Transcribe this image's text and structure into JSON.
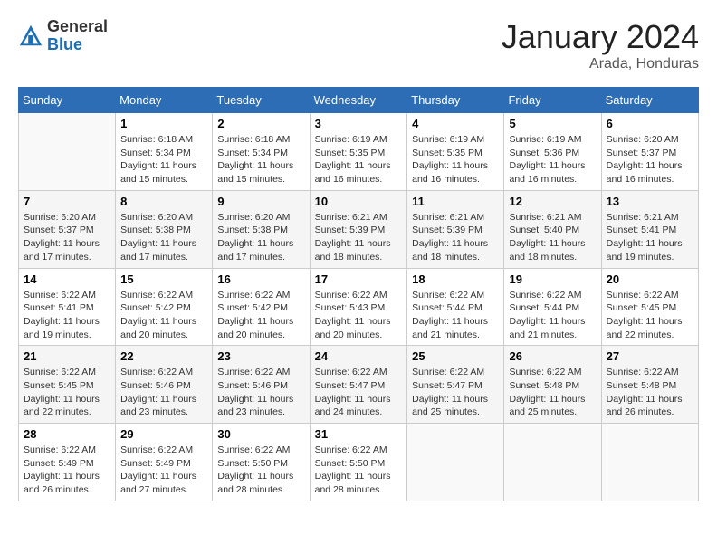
{
  "logo": {
    "general": "General",
    "blue": "Blue"
  },
  "title": {
    "month_year": "January 2024",
    "location": "Arada, Honduras"
  },
  "weekdays": [
    "Sunday",
    "Monday",
    "Tuesday",
    "Wednesday",
    "Thursday",
    "Friday",
    "Saturday"
  ],
  "weeks": [
    [
      {
        "day": "",
        "sunrise": "",
        "sunset": "",
        "daylight": ""
      },
      {
        "day": "1",
        "sunrise": "Sunrise: 6:18 AM",
        "sunset": "Sunset: 5:34 PM",
        "daylight": "Daylight: 11 hours and 15 minutes."
      },
      {
        "day": "2",
        "sunrise": "Sunrise: 6:18 AM",
        "sunset": "Sunset: 5:34 PM",
        "daylight": "Daylight: 11 hours and 15 minutes."
      },
      {
        "day": "3",
        "sunrise": "Sunrise: 6:19 AM",
        "sunset": "Sunset: 5:35 PM",
        "daylight": "Daylight: 11 hours and 16 minutes."
      },
      {
        "day": "4",
        "sunrise": "Sunrise: 6:19 AM",
        "sunset": "Sunset: 5:35 PM",
        "daylight": "Daylight: 11 hours and 16 minutes."
      },
      {
        "day": "5",
        "sunrise": "Sunrise: 6:19 AM",
        "sunset": "Sunset: 5:36 PM",
        "daylight": "Daylight: 11 hours and 16 minutes."
      },
      {
        "day": "6",
        "sunrise": "Sunrise: 6:20 AM",
        "sunset": "Sunset: 5:37 PM",
        "daylight": "Daylight: 11 hours and 16 minutes."
      }
    ],
    [
      {
        "day": "7",
        "sunrise": "Sunrise: 6:20 AM",
        "sunset": "Sunset: 5:37 PM",
        "daylight": "Daylight: 11 hours and 17 minutes."
      },
      {
        "day": "8",
        "sunrise": "Sunrise: 6:20 AM",
        "sunset": "Sunset: 5:38 PM",
        "daylight": "Daylight: 11 hours and 17 minutes."
      },
      {
        "day": "9",
        "sunrise": "Sunrise: 6:20 AM",
        "sunset": "Sunset: 5:38 PM",
        "daylight": "Daylight: 11 hours and 17 minutes."
      },
      {
        "day": "10",
        "sunrise": "Sunrise: 6:21 AM",
        "sunset": "Sunset: 5:39 PM",
        "daylight": "Daylight: 11 hours and 18 minutes."
      },
      {
        "day": "11",
        "sunrise": "Sunrise: 6:21 AM",
        "sunset": "Sunset: 5:39 PM",
        "daylight": "Daylight: 11 hours and 18 minutes."
      },
      {
        "day": "12",
        "sunrise": "Sunrise: 6:21 AM",
        "sunset": "Sunset: 5:40 PM",
        "daylight": "Daylight: 11 hours and 18 minutes."
      },
      {
        "day": "13",
        "sunrise": "Sunrise: 6:21 AM",
        "sunset": "Sunset: 5:41 PM",
        "daylight": "Daylight: 11 hours and 19 minutes."
      }
    ],
    [
      {
        "day": "14",
        "sunrise": "Sunrise: 6:22 AM",
        "sunset": "Sunset: 5:41 PM",
        "daylight": "Daylight: 11 hours and 19 minutes."
      },
      {
        "day": "15",
        "sunrise": "Sunrise: 6:22 AM",
        "sunset": "Sunset: 5:42 PM",
        "daylight": "Daylight: 11 hours and 20 minutes."
      },
      {
        "day": "16",
        "sunrise": "Sunrise: 6:22 AM",
        "sunset": "Sunset: 5:42 PM",
        "daylight": "Daylight: 11 hours and 20 minutes."
      },
      {
        "day": "17",
        "sunrise": "Sunrise: 6:22 AM",
        "sunset": "Sunset: 5:43 PM",
        "daylight": "Daylight: 11 hours and 20 minutes."
      },
      {
        "day": "18",
        "sunrise": "Sunrise: 6:22 AM",
        "sunset": "Sunset: 5:44 PM",
        "daylight": "Daylight: 11 hours and 21 minutes."
      },
      {
        "day": "19",
        "sunrise": "Sunrise: 6:22 AM",
        "sunset": "Sunset: 5:44 PM",
        "daylight": "Daylight: 11 hours and 21 minutes."
      },
      {
        "day": "20",
        "sunrise": "Sunrise: 6:22 AM",
        "sunset": "Sunset: 5:45 PM",
        "daylight": "Daylight: 11 hours and 22 minutes."
      }
    ],
    [
      {
        "day": "21",
        "sunrise": "Sunrise: 6:22 AM",
        "sunset": "Sunset: 5:45 PM",
        "daylight": "Daylight: 11 hours and 22 minutes."
      },
      {
        "day": "22",
        "sunrise": "Sunrise: 6:22 AM",
        "sunset": "Sunset: 5:46 PM",
        "daylight": "Daylight: 11 hours and 23 minutes."
      },
      {
        "day": "23",
        "sunrise": "Sunrise: 6:22 AM",
        "sunset": "Sunset: 5:46 PM",
        "daylight": "Daylight: 11 hours and 23 minutes."
      },
      {
        "day": "24",
        "sunrise": "Sunrise: 6:22 AM",
        "sunset": "Sunset: 5:47 PM",
        "daylight": "Daylight: 11 hours and 24 minutes."
      },
      {
        "day": "25",
        "sunrise": "Sunrise: 6:22 AM",
        "sunset": "Sunset: 5:47 PM",
        "daylight": "Daylight: 11 hours and 25 minutes."
      },
      {
        "day": "26",
        "sunrise": "Sunrise: 6:22 AM",
        "sunset": "Sunset: 5:48 PM",
        "daylight": "Daylight: 11 hours and 25 minutes."
      },
      {
        "day": "27",
        "sunrise": "Sunrise: 6:22 AM",
        "sunset": "Sunset: 5:48 PM",
        "daylight": "Daylight: 11 hours and 26 minutes."
      }
    ],
    [
      {
        "day": "28",
        "sunrise": "Sunrise: 6:22 AM",
        "sunset": "Sunset: 5:49 PM",
        "daylight": "Daylight: 11 hours and 26 minutes."
      },
      {
        "day": "29",
        "sunrise": "Sunrise: 6:22 AM",
        "sunset": "Sunset: 5:49 PM",
        "daylight": "Daylight: 11 hours and 27 minutes."
      },
      {
        "day": "30",
        "sunrise": "Sunrise: 6:22 AM",
        "sunset": "Sunset: 5:50 PM",
        "daylight": "Daylight: 11 hours and 28 minutes."
      },
      {
        "day": "31",
        "sunrise": "Sunrise: 6:22 AM",
        "sunset": "Sunset: 5:50 PM",
        "daylight": "Daylight: 11 hours and 28 minutes."
      },
      {
        "day": "",
        "sunrise": "",
        "sunset": "",
        "daylight": ""
      },
      {
        "day": "",
        "sunrise": "",
        "sunset": "",
        "daylight": ""
      },
      {
        "day": "",
        "sunrise": "",
        "sunset": "",
        "daylight": ""
      }
    ]
  ]
}
